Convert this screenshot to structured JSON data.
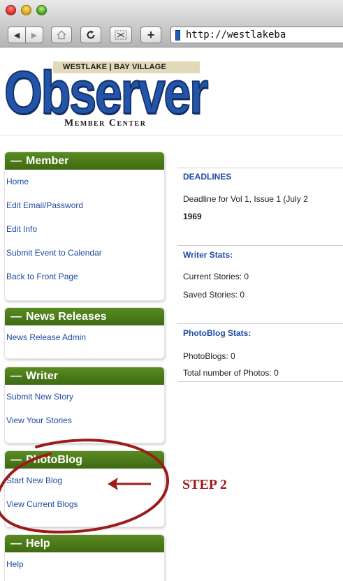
{
  "browser": {
    "back_label": "◀",
    "forward_label": "▶",
    "add_label": "+",
    "url": "http://westlakeba"
  },
  "header": {
    "ribbon": "WESTLAKE | BAY VILLAGE",
    "logo": "Observer",
    "subtitle": "Member Center"
  },
  "sidebar": {
    "member": {
      "title": "Member",
      "items": [
        "Home",
        "Edit Email/Password",
        "Edit Info",
        "Submit Event to Calendar",
        "Back to Front Page"
      ]
    },
    "news": {
      "title": "News Releases",
      "items": [
        "News Release Admin"
      ]
    },
    "writer": {
      "title": "Writer",
      "items": [
        "Submit New Story",
        "View Your Stories"
      ]
    },
    "photoblog": {
      "title": "PhotoBlog",
      "items": [
        "Start New Blog",
        "View Current Blogs"
      ]
    },
    "help": {
      "title": "Help",
      "items": [
        "Help"
      ]
    }
  },
  "content": {
    "deadlines": {
      "title": "DEADLINES",
      "line1": "Deadline for Vol 1, Issue 1 (July 2",
      "line2": "1969"
    },
    "writer_stats": {
      "title": "Writer Stats:",
      "current": "Current Stories: 0",
      "saved": "Saved Stories: 0"
    },
    "photoblog_stats": {
      "title": "PhotoBlog Stats:",
      "blogs": "PhotoBlogs: 0",
      "photos": "Total number of Photos: 0"
    }
  },
  "annotation": {
    "label": "STEP 2",
    "color": "#9b1b1b"
  },
  "colors": {
    "panel_header": "#4a7a18",
    "link": "#1e4aa3",
    "logo": "#2454a8"
  }
}
